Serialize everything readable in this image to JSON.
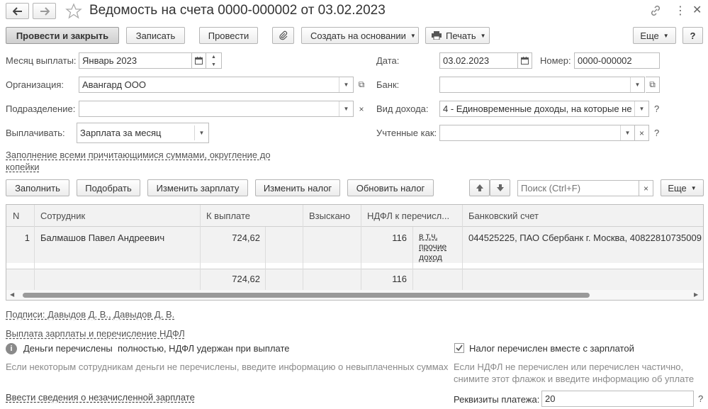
{
  "window": {
    "title": "Ведомость на счета 0000-000002 от 03.02.2023"
  },
  "toolbar": {
    "post_close": "Провести и закрыть",
    "save": "Записать",
    "post": "Провести",
    "create_based": "Создать на основании",
    "print": "Печать",
    "more": "Еще",
    "help": "?"
  },
  "form": {
    "month_label": "Месяц выплаты:",
    "month_value": "Январь 2023",
    "date_label": "Дата:",
    "date_value": "03.02.2023",
    "number_label": "Номер:",
    "number_value": "0000-000002",
    "org_label": "Организация:",
    "org_value": "Авангард ООО",
    "bank_label": "Банк:",
    "bank_value": "",
    "dept_label": "Подразделение:",
    "dept_value": "",
    "income_label": "Вид дохода:",
    "income_value": "4 - Единовременные доходы, на которые не",
    "pay_label": "Выплачивать:",
    "pay_value": "Зарплата за месяц",
    "counted_label": "Учтенные как:",
    "counted_value": "",
    "fill_link": "Заполнение всеми причитающимися суммами, округление до",
    "fill_link2": "копейки",
    "q": "?"
  },
  "table_toolbar": {
    "fill": "Заполнить",
    "select": "Подобрать",
    "change_salary": "Изменить зарплату",
    "change_tax": "Изменить налог",
    "update_tax": "Обновить налог",
    "search_placeholder": "Поиск (Ctrl+F)",
    "more": "Еще"
  },
  "table": {
    "columns": [
      "N",
      "Сотрудник",
      "К выплате",
      "Взыскано",
      "НДФЛ к перечисл...",
      "Банковский счет"
    ],
    "rows": [
      {
        "n": "1",
        "employee": "Балмашов Павел Андреевич",
        "to_pay": "724,62",
        "withheld": "",
        "ndfl": "116",
        "ndfl_note1": "в т.ч.",
        "ndfl_note2": "прочие",
        "ndfl_note3": "доход",
        "account": "044525225, ПАО Сбербанк г. Москва, 40822810735009"
      }
    ],
    "totals": {
      "to_pay": "724,62",
      "ndfl": "116"
    }
  },
  "footer": {
    "signatures_link": "Подписи: Давыдов Д. В., Давыдов Д. В.",
    "payment_link": "Выплата зарплаты и перечисление НДФЛ",
    "paid_status": "Деньги перечислены  полностью, НДФЛ удержан при выплате",
    "paid_hint": "Если некоторым сотрудникам деньги не перечислены, введите информацию о невыплаченных суммах",
    "tax_checkbox_label": "Налог перечислен вместе с зарплатой",
    "tax_hint1": "Если НДФЛ не перечислен или перечислен частично,",
    "tax_hint2": "снимите этот флажок и введите информацию об уплате",
    "unpaid_link": "Ввести сведения о незачисленной зарплате",
    "payment_details_label": "Реквизиты платежа:",
    "payment_details_value": "20",
    "q": "?"
  }
}
